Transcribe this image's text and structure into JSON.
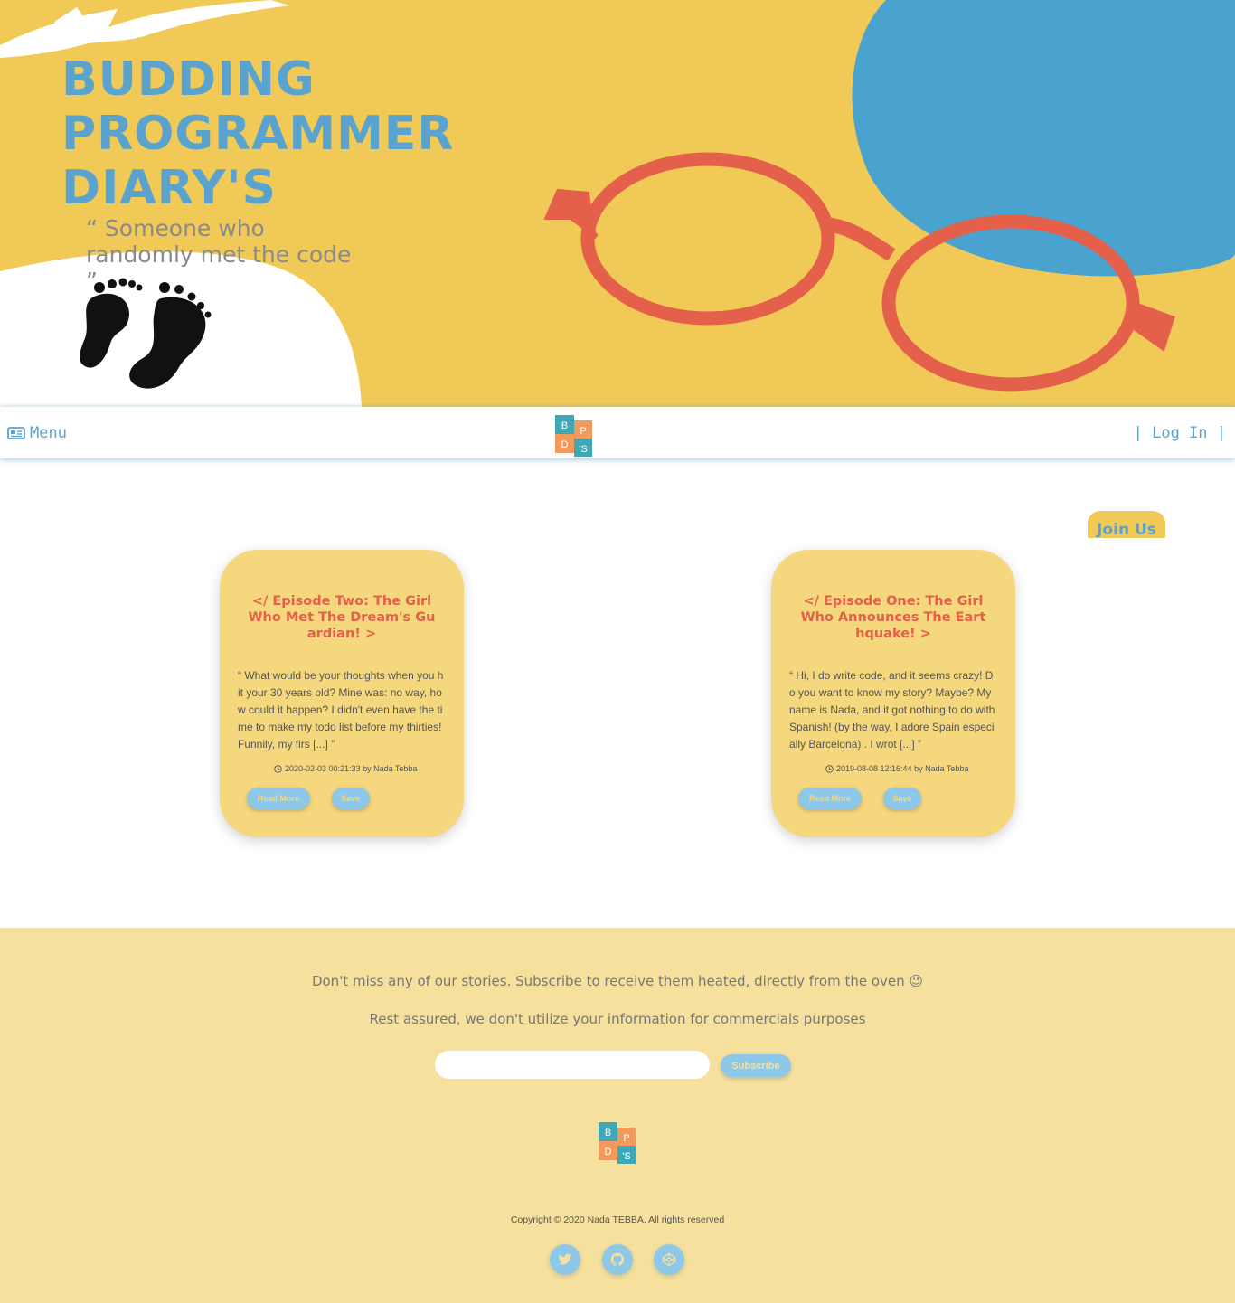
{
  "hero": {
    "title_lines": [
      "BUDDING",
      "PROGRAMMER",
      "DIARY'S"
    ],
    "tagline": "“ Someone who randomly met the code ”",
    "colors": {
      "background": "#f0c957",
      "blob": "#4aa3cf",
      "glasses": "#e5604a",
      "title": "#5aa3cf"
    }
  },
  "navbar": {
    "menu_label": "Menu",
    "menu_icon": "newspaper-icon",
    "logo_letters": [
      "B",
      "P",
      "D",
      "'S"
    ],
    "login_label": "| Log In |"
  },
  "join_us": {
    "label": "Join Us"
  },
  "posts": [
    {
      "title": "</ Episode Two: The Girl Who Met The Dream's Guardian! >",
      "excerpt": "“ What would be your thoughts when you hit your 30 years old? Mine was: no way, how could it happen? I didn't even have the time to make my todo list before my thirties! Funnily, my firs [...] ”",
      "meta": "2020-02-03 00:21:33 by Nada Tebba",
      "read_more": "Read More",
      "save": "Save"
    },
    {
      "title": "</ Episode One: The Girl Who Announces The Earthquake! >",
      "excerpt": "“ Hi, I do write code, and it seems crazy! Do you want to know my story? Maybe? My name is Nada, and it got nothing to do with Spanish! (by the way, I adore Spain especially Barcelona) . I wrot [...] ”",
      "meta": "2019-08-08 12:16:44 by Nada Tebba",
      "read_more": "Read More",
      "save": "Save"
    }
  ],
  "footer": {
    "message1": "Don't miss any of our stories. Subscribe to receive them heated, directly from the oven 😉",
    "message2": "Rest assured, we don't utilize your information for commercials purposes",
    "email_value": "",
    "subscribe_label": "Subscribe",
    "copyright": "Copyright © 2020 Nada TEBBA. All rights reserved",
    "social_icons": [
      "twitter-icon",
      "github-icon",
      "codepen-icon"
    ]
  }
}
